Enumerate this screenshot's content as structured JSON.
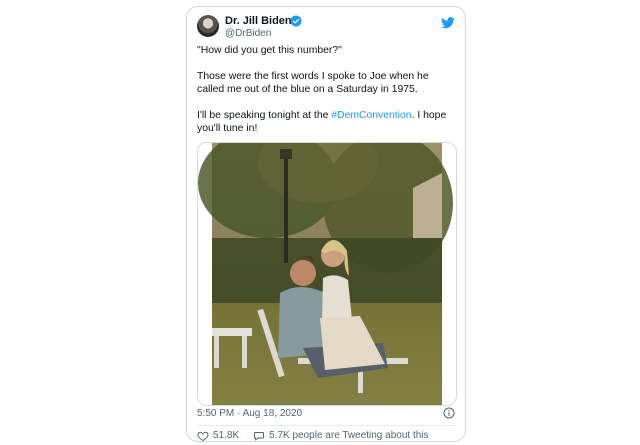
{
  "tweet": {
    "author_name": "Dr. Jill Biden",
    "handle": "@DrBiden",
    "text_line1": "\"How did you get this number?\"",
    "text_line2": "Those were the first words I spoke to Joe when he called me out of the blue on a Saturday in 1975.",
    "text_line3_before": "I'll be speaking tonight at the ",
    "hashtag": "#DemConvention",
    "text_line3_after": ". I hope you'll tune in!",
    "timestamp": "5:50 PM · Aug 18, 2020",
    "likes": "51.8K",
    "tweeting_about": "5.7K people are Tweeting about this"
  },
  "colors": {
    "accent": "#1d9bf0",
    "secondary_text": "#536471",
    "border": "#cfd9de"
  },
  "icons": {
    "verified": "verified-badge-icon",
    "bird": "twitter-bird-icon",
    "info": "info-icon",
    "heart": "heart-icon",
    "comment": "speech-bubble-icon"
  }
}
